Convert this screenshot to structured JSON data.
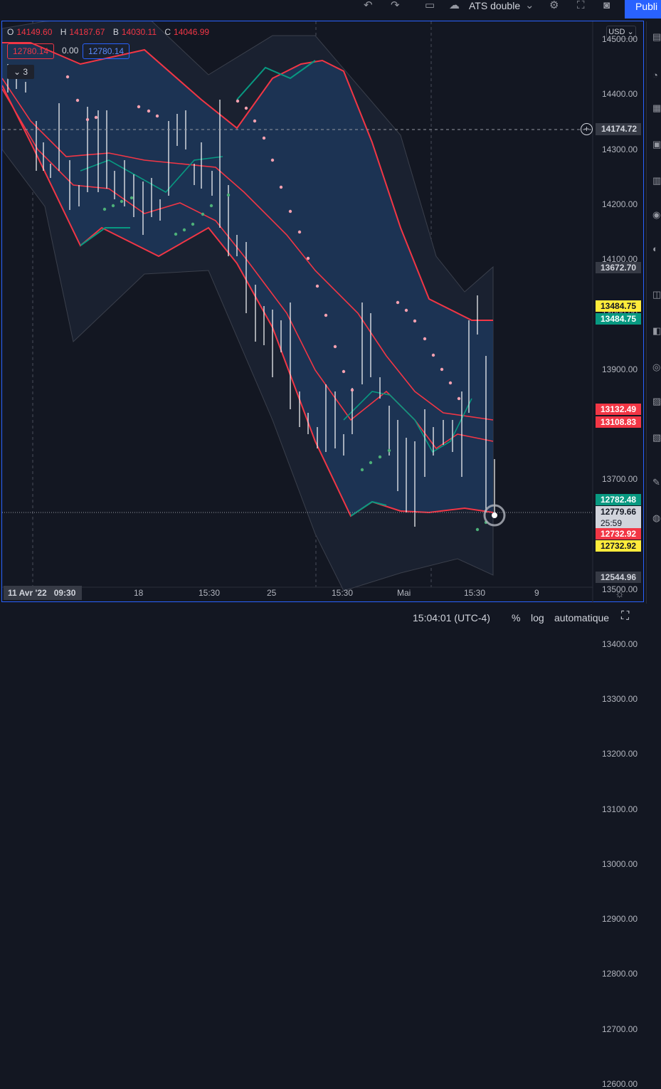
{
  "toolbar": {
    "undo_icon": "undo-icon",
    "redo_icon": "redo-icon",
    "layout_icon": "layout-icon",
    "layout_name": "ATS double",
    "settings_icon": "gear-icon",
    "fullscreen_icon": "fullscreen-icon",
    "snapshot_icon": "camera-icon",
    "publish_label": "Publi"
  },
  "legend": {
    "open_key": "O",
    "open": "14149.60",
    "high_key": "H",
    "high": "14187.67",
    "low_key": "B",
    "low": "14030.11",
    "close_key": "C",
    "close": "14046.99",
    "ind_a": "12780.14",
    "ind_b": "0.00",
    "ind_c": "12780.14",
    "collapse_count": "3"
  },
  "currency": "USD",
  "price_axis": {
    "ticks": [
      "14500.00",
      "14400.00",
      "14300.00",
      "14200.00",
      "14100.00",
      "14000.00",
      "13900.00",
      "13800.00",
      "13700.00",
      "13600.00",
      "13500.00",
      "13400.00",
      "13300.00",
      "13200.00",
      "13100.00",
      "13000.00",
      "12900.00",
      "12800.00",
      "12700.00",
      "12600.00"
    ],
    "crosshair_price": "14174.72",
    "badges": [
      {
        "text": "13672.70",
        "bg": "#363a45",
        "fg": "#d1d4dc"
      },
      {
        "text": "13484.75",
        "bg": "#ffeb3b",
        "fg": "#131722"
      },
      {
        "text": "13484.75",
        "bg": "#089981",
        "fg": "#ffffff"
      },
      {
        "text": "13132.49",
        "bg": "#f23645",
        "fg": "#ffffff"
      },
      {
        "text": "13108.83",
        "bg": "#f23645",
        "fg": "#ffffff"
      },
      {
        "text": "12782.48",
        "bg": "#089981",
        "fg": "#ffffff"
      },
      {
        "text": "12779.66",
        "bg": "#d1d4dc",
        "fg": "#131722"
      },
      {
        "text": "25:59",
        "bg": "#d1d4dc",
        "fg": "#131722"
      },
      {
        "text": "12732.92",
        "bg": "#f23645",
        "fg": "#ffffff"
      },
      {
        "text": "12732.92",
        "bg": "#ffeb3b",
        "fg": "#131722"
      },
      {
        "text": "12544.96",
        "bg": "#363a45",
        "fg": "#d1d4dc"
      }
    ]
  },
  "time_axis": {
    "crosshair_date": "11 Avr '22",
    "crosshair_time": "09:30",
    "labels": [
      "18",
      "15:30",
      "25",
      "15:30",
      "Mai",
      "15:30",
      "9"
    ]
  },
  "status": {
    "clock": "15:04:01 (UTC-4)",
    "percent": "%",
    "log": "log",
    "auto": "automatique"
  },
  "colors": {
    "background": "#131722",
    "band_fill": "#1e3a5f",
    "band_upper": "#f23645",
    "band_lower": "#089981",
    "psar_bear": "#f7a1b0",
    "psar_bull": "#4caf78",
    "bars": "#ffffff",
    "accent": "#2962ff"
  },
  "chart_data": {
    "type": "line",
    "title": "",
    "ylim": [
      12500,
      14550
    ],
    "bands": {
      "upper": [
        14420,
        14300,
        14200,
        14100,
        14000,
        13900,
        13850,
        13870,
        14000,
        14200,
        14430,
        14420,
        14150,
        13900,
        13650,
        13480,
        13490
      ],
      "middle": [
        14200,
        14050,
        13980,
        13960,
        14000,
        14050,
        14030,
        13950,
        13720,
        13470,
        13300,
        13220,
        13160,
        13130,
        13110
      ],
      "lower": [
        14000,
        13750,
        13820,
        13680,
        13830,
        13800,
        13600,
        13250,
        12930,
        12760,
        12790,
        12760,
        12780,
        12770,
        12732
      ]
    }
  }
}
